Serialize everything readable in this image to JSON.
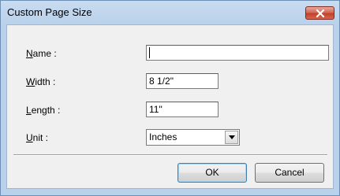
{
  "window": {
    "title": "Custom Page Size"
  },
  "fields": {
    "name": {
      "label_prefix": "",
      "label_key": "N",
      "label_rest": "ame :",
      "value": ""
    },
    "width": {
      "label_prefix": "",
      "label_key": "W",
      "label_rest": "idth :",
      "value": "8 1/2\""
    },
    "length": {
      "label_prefix": "",
      "label_key": "L",
      "label_rest": "ength :",
      "value": "11\""
    },
    "unit": {
      "label_prefix": "",
      "label_key": "U",
      "label_rest": "nit :",
      "selected": "Inches"
    }
  },
  "buttons": {
    "ok": "OK",
    "cancel": "Cancel"
  },
  "icons": {
    "close": "close-icon",
    "dropdown": "chevron-down-icon"
  },
  "colors": {
    "close_button": "#c2402c",
    "window_frame": "#b9d1ea",
    "client_background": "#f0f0f0"
  }
}
